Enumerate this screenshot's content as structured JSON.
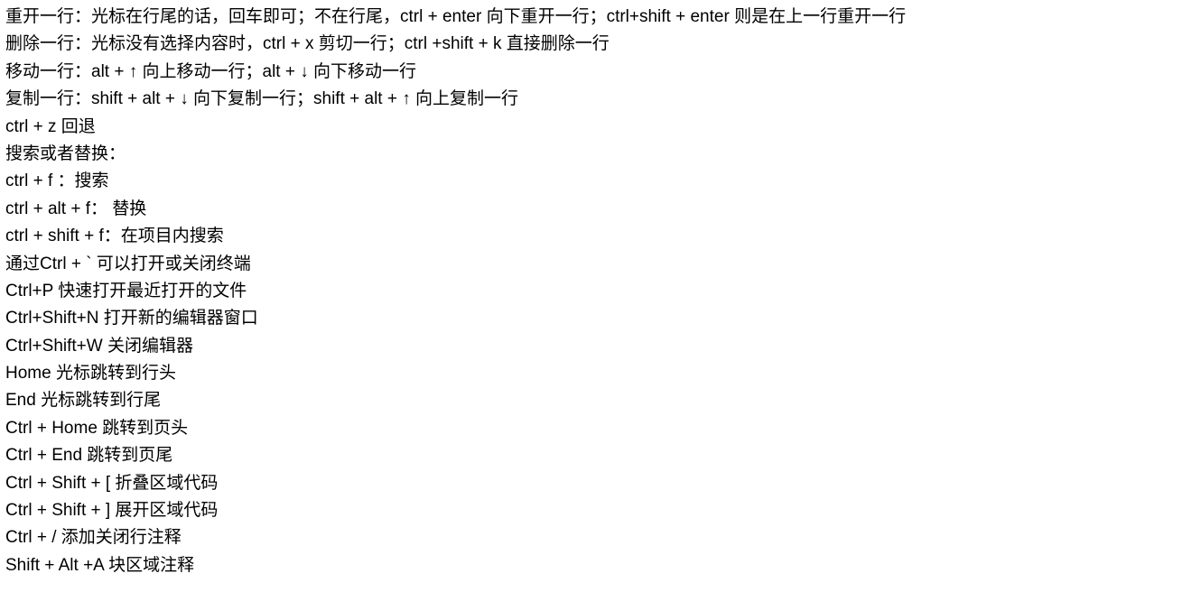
{
  "lines": [
    "重开一行：光标在行尾的话，回车即可；不在行尾，ctrl + enter 向下重开一行；ctrl+shift + enter 则是在上一行重开一行",
    "删除一行：光标没有选择内容时，ctrl + x 剪切一行；ctrl +shift + k 直接删除一行",
    "移动一行：alt + ↑ 向上移动一行；alt + ↓ 向下移动一行",
    "复制一行：shift + alt + ↓ 向下复制一行；shift + alt + ↑ 向上复制一行",
    "ctrl + z 回退",
    "搜索或者替换：",
    "ctrl + f ：搜索",
    "ctrl + alt + f： 替换",
    "ctrl + shift + f：在项目内搜索",
    "通过Ctrl + ` 可以打开或关闭终端",
    "Ctrl+P 快速打开最近打开的文件",
    "Ctrl+Shift+N 打开新的编辑器窗口",
    "Ctrl+Shift+W 关闭编辑器",
    "Home 光标跳转到行头",
    "End 光标跳转到行尾",
    "Ctrl + Home 跳转到页头",
    "Ctrl + End 跳转到页尾",
    "Ctrl + Shift + [ 折叠区域代码",
    "Ctrl + Shift + ] 展开区域代码",
    "Ctrl + / 添加关闭行注释",
    "Shift + Alt +A 块区域注释"
  ]
}
